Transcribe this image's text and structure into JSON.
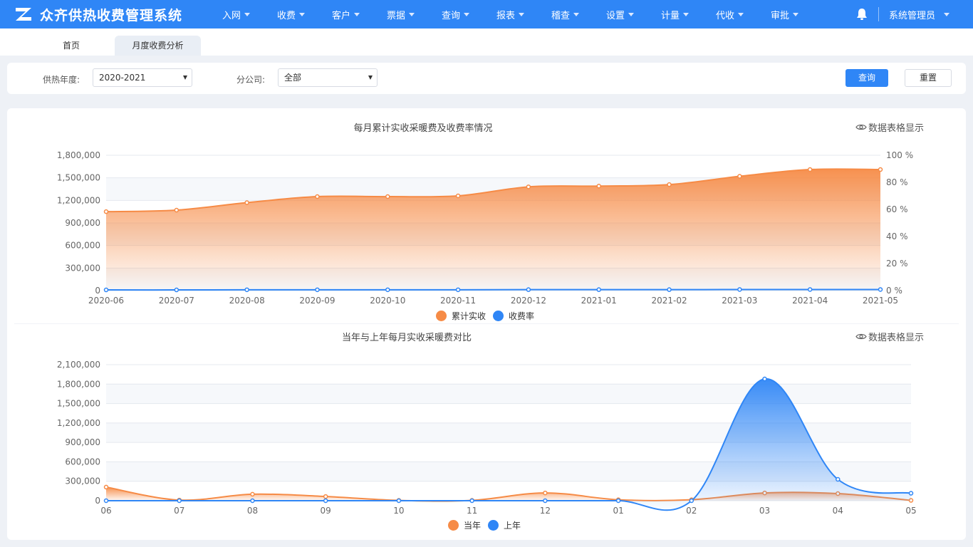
{
  "app": {
    "title": "众齐供热收费管理系统"
  },
  "nav": [
    {
      "label": "入网"
    },
    {
      "label": "收费"
    },
    {
      "label": "客户"
    },
    {
      "label": "票据"
    },
    {
      "label": "查询"
    },
    {
      "label": "报表"
    },
    {
      "label": "稽查"
    },
    {
      "label": "设置"
    },
    {
      "label": "计量"
    },
    {
      "label": "代收"
    },
    {
      "label": "审批"
    }
  ],
  "user": {
    "name": "系统管理员"
  },
  "tabs": [
    {
      "label": "首页"
    },
    {
      "label": "月度收费分析"
    }
  ],
  "filters": {
    "season_label": "供热年度:",
    "season_value": "2020-2021",
    "company_label": "分公司:",
    "company_value": "全部",
    "query_label": "查询",
    "reset_label": "重置"
  },
  "table_toggle_label": "数据表格显示",
  "colors": {
    "primary": "#2f86f6",
    "orange": "#f68b46",
    "blue": "#2f86f6"
  },
  "chart_data": [
    {
      "type": "area",
      "title": "每月累计实收采暖费及收费率情况",
      "categories": [
        "2020-06",
        "2020-07",
        "2020-08",
        "2020-09",
        "2020-10",
        "2020-11",
        "2020-12",
        "2021-01",
        "2021-02",
        "2021-03",
        "2021-04",
        "2021-05"
      ],
      "y_left": {
        "min": 0,
        "max": 1800000,
        "ticks": [
          "0",
          "300,000",
          "600,000",
          "900,000",
          "1,200,000",
          "1,500,000",
          "1,800,000"
        ]
      },
      "y_right": {
        "min": 0,
        "max": 100,
        "ticks": [
          "0 %",
          "20 %",
          "40 %",
          "60 %",
          "80 %",
          "100 %"
        ]
      },
      "series": [
        {
          "name": "累计实收",
          "axis": "left",
          "color": "#f68b46",
          "area": true,
          "values": [
            1050000,
            1070000,
            1170000,
            1250000,
            1250000,
            1260000,
            1380000,
            1390000,
            1410000,
            1520000,
            1610000,
            1610000
          ]
        },
        {
          "name": "收费率",
          "axis": "right",
          "color": "#2f86f6",
          "area": false,
          "values": [
            0.5,
            0.5,
            0.6,
            0.6,
            0.6,
            0.6,
            0.7,
            0.7,
            0.7,
            0.8,
            0.8,
            0.8
          ]
        }
      ],
      "legend_position": "bottom-center",
      "grid": true
    },
    {
      "type": "area",
      "title": "当年与上年每月实收采暖费对比",
      "categories": [
        "06",
        "07",
        "08",
        "09",
        "10",
        "11",
        "12",
        "01",
        "02",
        "03",
        "04",
        "05"
      ],
      "y_left": {
        "min": 0,
        "max": 2100000,
        "ticks": [
          "0",
          "300,000",
          "600,000",
          "900,000",
          "1,200,000",
          "1,500,000",
          "1,800,000",
          "2,100,000"
        ]
      },
      "series": [
        {
          "name": "当年",
          "color": "#f68b46",
          "area": true,
          "values": [
            210000,
            10000,
            100000,
            65000,
            5000,
            5000,
            120000,
            15000,
            15000,
            120000,
            110000,
            5000
          ]
        },
        {
          "name": "上年",
          "color": "#2f86f6",
          "area": true,
          "values": [
            0,
            0,
            0,
            0,
            0,
            0,
            0,
            0,
            0,
            1880000,
            330000,
            115000
          ]
        }
      ],
      "legend_position": "bottom-center",
      "grid": true
    }
  ]
}
